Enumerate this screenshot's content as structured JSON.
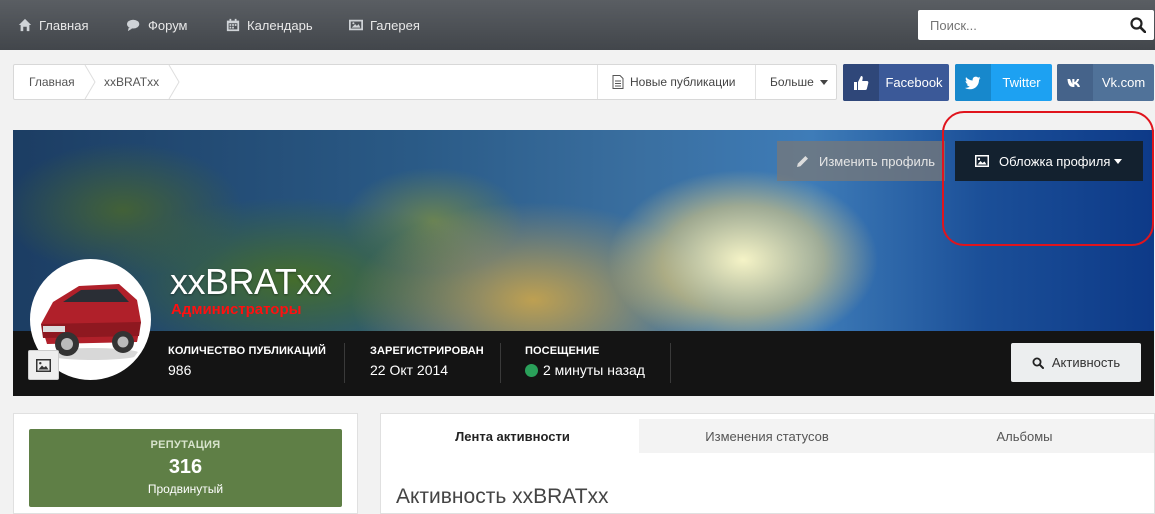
{
  "nav": {
    "items": [
      {
        "label": "Главная",
        "icon": "home-icon"
      },
      {
        "label": "Форум",
        "icon": "chat-icon"
      },
      {
        "label": "Календарь",
        "icon": "calendar-icon"
      },
      {
        "label": "Галерея",
        "icon": "image-icon"
      }
    ],
    "search_placeholder": "Поиск..."
  },
  "breadcrumb": {
    "items": [
      "Главная",
      "xxBRATxx"
    ],
    "new_posts_label": "Новые публикации",
    "more_label": "Больше"
  },
  "social": [
    {
      "label": "Facebook",
      "icon": "thumbs-up-icon",
      "color": "#3b5998"
    },
    {
      "label": "Twitter",
      "icon": "twitter-icon",
      "color": "#1da1f2"
    },
    {
      "label": "Vk.com",
      "icon": "vk-icon",
      "color": "#507299"
    }
  ],
  "cover": {
    "edit_profile_label": "Изменить профиль",
    "cover_label": "Обложка профиля"
  },
  "profile": {
    "username": "xxBRATxx",
    "group": "Администраторы",
    "group_color": "#ff1010",
    "stats": [
      {
        "key": "КОЛИЧЕСТВО ПУБЛИКАЦИЙ",
        "value": "986"
      },
      {
        "key": "ЗАРЕГИСТРИРОВАН",
        "value": "22 Окт 2014"
      },
      {
        "key": "ПОСЕЩЕНИЕ",
        "value": "2 минуты назад"
      }
    ],
    "activity_label": "Активность"
  },
  "reputation": {
    "title": "РЕПУТАЦИЯ",
    "value": "316",
    "level": "Продвинутый",
    "color": "#5f7f46"
  },
  "tabs": {
    "items": [
      "Лента активности",
      "Изменения статусов",
      "Альбомы"
    ]
  },
  "feed": {
    "title": "Активность xxBRATxx"
  },
  "colors": {
    "highlight": "#e0141d",
    "online": "#2aa05a"
  }
}
